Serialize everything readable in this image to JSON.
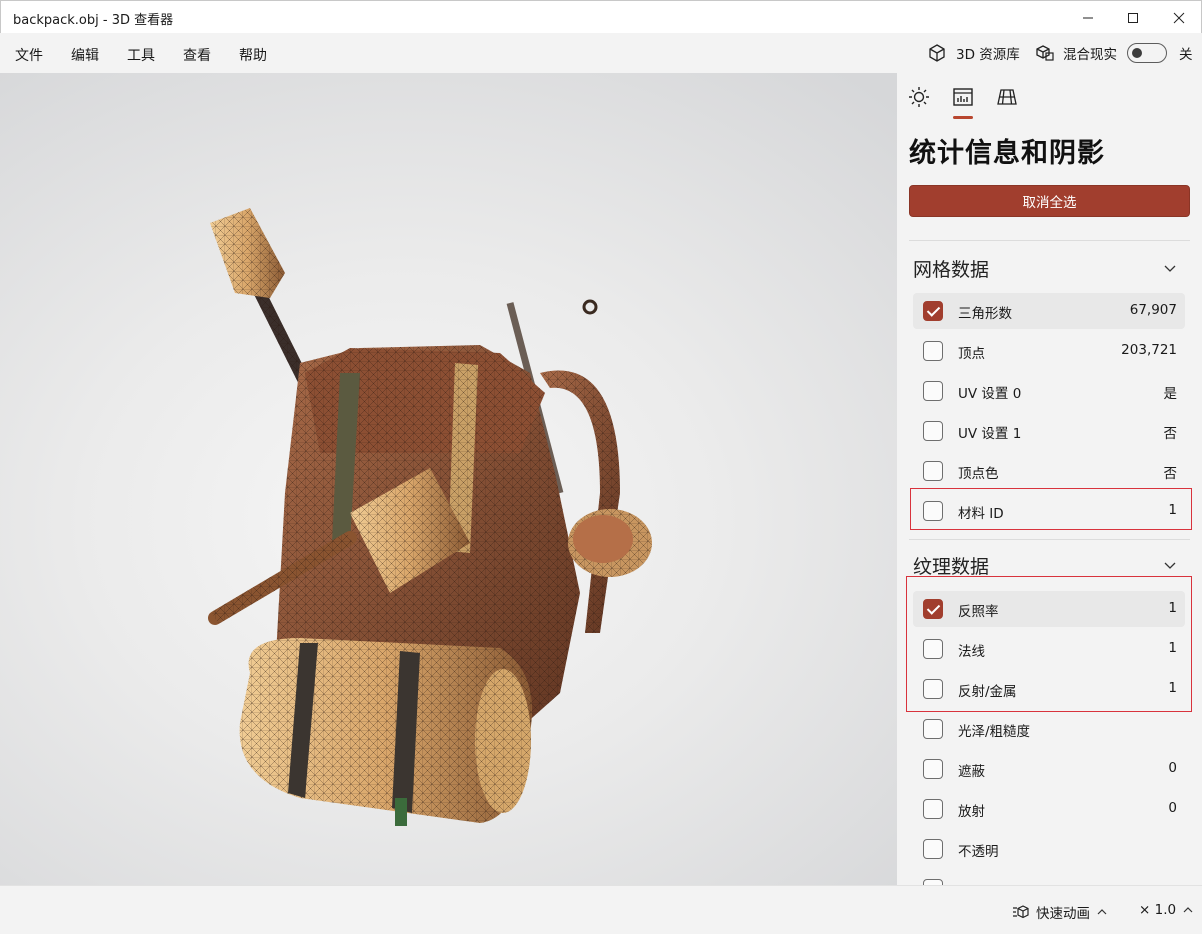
{
  "window": {
    "title": "backpack.obj - 3D 查看器",
    "minimize_icon": "minimize-icon",
    "maximize_icon": "maximize-icon",
    "close_icon": "close-icon"
  },
  "menu": {
    "items": [
      "文件",
      "编辑",
      "工具",
      "查看",
      "帮助"
    ],
    "library_label": "3D 资源库",
    "mixed_reality_label": "混合现实",
    "toggle_state": "关"
  },
  "panel": {
    "tabs": [
      "lighting-icon",
      "stats-icon",
      "grid-icon"
    ],
    "active_tab": 1,
    "title": "统计信息和阴影",
    "deselect_all": "取消全选",
    "mesh_section": {
      "title": "网格数据",
      "rows": [
        {
          "label": "三角形数",
          "value": "67,907",
          "checked": true
        },
        {
          "label": "顶点",
          "value": "203,721",
          "checked": false
        },
        {
          "label": "UV 设置 0",
          "value": "是",
          "checked": false
        },
        {
          "label": "UV 设置 1",
          "value": "否",
          "checked": false
        },
        {
          "label": "顶点色",
          "value": "否",
          "checked": false
        },
        {
          "label": "材料 ID",
          "value": "1",
          "checked": false
        }
      ]
    },
    "texture_section": {
      "title": "纹理数据",
      "rows": [
        {
          "label": "反照率",
          "value": "1",
          "checked": true
        },
        {
          "label": "法线",
          "value": "1",
          "checked": false
        },
        {
          "label": "反射/金属",
          "value": "1",
          "checked": false
        },
        {
          "label": "光泽/粗糙度",
          "value": "",
          "checked": false
        },
        {
          "label": "遮蔽",
          "value": "0",
          "checked": false
        },
        {
          "label": "放射",
          "value": "0",
          "checked": false
        },
        {
          "label": "不透明",
          "value": "",
          "checked": false
        }
      ]
    }
  },
  "status": {
    "animation_label": "快速动画",
    "speed": "× 1.0"
  },
  "colors": {
    "accent": "#a13e2e",
    "highlight_box": "#d8323c"
  }
}
